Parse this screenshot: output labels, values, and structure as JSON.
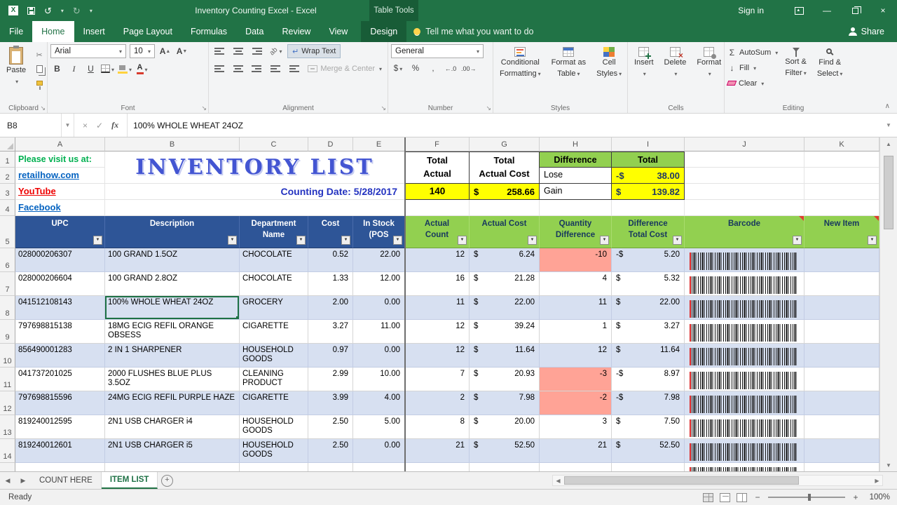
{
  "titlebar": {
    "title": "Inventory Counting Excel  -  Excel",
    "context_group": "Table Tools",
    "sign_in": "Sign in"
  },
  "tabs": {
    "file": "File",
    "home": "Home",
    "insert": "Insert",
    "page_layout": "Page Layout",
    "formulas": "Formulas",
    "data": "Data",
    "review": "Review",
    "view": "View",
    "design": "Design",
    "tell_me": "Tell me what you want to do",
    "share": "Share"
  },
  "ribbon": {
    "clipboard": {
      "paste": "Paste",
      "label": "Clipboard"
    },
    "font": {
      "name": "Arial",
      "size": "10",
      "bold": "B",
      "italic": "I",
      "underline": "U",
      "label": "Font"
    },
    "alignment": {
      "wrap": "Wrap Text",
      "merge": "Merge & Center",
      "label": "Alignment"
    },
    "number": {
      "format": "General",
      "label": "Number"
    },
    "styles": {
      "cond1": "Conditional",
      "cond2": "Formatting",
      "ft1": "Format as",
      "ft2": "Table",
      "cs1": "Cell",
      "cs2": "Styles",
      "label": "Styles"
    },
    "cells": {
      "insert": "Insert",
      "delete": "Delete",
      "format": "Format",
      "label": "Cells"
    },
    "editing": {
      "autosum": "AutoSum",
      "fill": "Fill",
      "clear": "Clear",
      "sort1": "Sort &",
      "sort2": "Filter",
      "find1": "Find &",
      "find2": "Select",
      "label": "Editing"
    }
  },
  "icons": {
    "cut": "✂",
    "undo": "↺",
    "redo": "↻",
    "sigma": "Σ",
    "fill_down": "↓",
    "wrap_return": "↵",
    "orientation": "ab",
    "letter_a": "A",
    "check": "✓",
    "cancel": "×",
    "minimize": "—",
    "close": "×",
    "dollar": "$",
    "percent": "%",
    "comma": ",",
    "inc_decimal": "←.0",
    "dec_decimal": ".00→"
  },
  "formula_bar": {
    "name_box": "B8",
    "fx": "fx",
    "content": "100% WHOLE WHEAT 24OZ"
  },
  "grid": {
    "columns": [
      "A",
      "B",
      "C",
      "D",
      "E",
      "F",
      "G",
      "H",
      "I",
      "J",
      "K"
    ],
    "rows": [
      "1",
      "2",
      "3",
      "4",
      "5",
      "6",
      "7",
      "8",
      "9",
      "10",
      "11",
      "12",
      "13",
      "14"
    ]
  },
  "info": {
    "visit": "Please visit us at:",
    "link1": "retailhow.com",
    "link2": "YouTube",
    "link3": "Facebook",
    "title": "INVENTORY LIST",
    "date": "Counting Date: 5/28/2017"
  },
  "summary": {
    "total_actual_1": "Total",
    "total_actual_2": "Actual",
    "total_cost_1": "Total",
    "total_cost_2": "Actual Cost",
    "difference": "Difference",
    "total": "Total",
    "lose": "Lose",
    "gain": "Gain",
    "actual_value": "140",
    "cost_cur": "$",
    "cost_value": "258.66",
    "lose_cur": "-$",
    "lose_value": "38.00",
    "gain_cur": "$",
    "gain_value": "139.82"
  },
  "table": {
    "headers": {
      "upc": "UPC",
      "description": "Description",
      "dept1": "Department",
      "dept2": "Name",
      "cost": "Cost",
      "stock1": "In Stock",
      "stock2": "(POS",
      "count1": "Actual",
      "count2": "Count",
      "acost": "Actual Cost",
      "qty1": "Quantity",
      "qty2": "Difference",
      "diff1": "Difference",
      "diff2": "Total Cost",
      "barcode": "Barcode",
      "new_item": "New Item"
    },
    "rows": [
      {
        "upc": "028000206307",
        "desc": "100 GRAND 1.5OZ",
        "dept": "CHOCOLATE",
        "cost": "0.52",
        "stock": "22.00",
        "count": "12",
        "cur": "$",
        "acost": "6.24",
        "qdiff": "-10",
        "dcur": "-$",
        "dcost": "5.20"
      },
      {
        "upc": "028000206604",
        "desc": "100 GRAND 2.8OZ",
        "dept": "CHOCOLATE",
        "cost": "1.33",
        "stock": "12.00",
        "count": "16",
        "cur": "$",
        "acost": "21.28",
        "qdiff": "4",
        "dcur": "$",
        "dcost": "5.32"
      },
      {
        "upc": "041512108143",
        "desc": "100% WHOLE WHEAT 24OZ",
        "dept": "GROCERY",
        "cost": "2.00",
        "stock": "0.00",
        "count": "11",
        "cur": "$",
        "acost": "22.00",
        "qdiff": "11",
        "dcur": "$",
        "dcost": "22.00"
      },
      {
        "upc": "797698815138",
        "desc": "18MG ECIG REFIL ORANGE OBSESS",
        "dept": "CIGARETTE",
        "cost": "3.27",
        "stock": "11.00",
        "count": "12",
        "cur": "$",
        "acost": "39.24",
        "qdiff": "1",
        "dcur": "$",
        "dcost": "3.27"
      },
      {
        "upc": "856490001283",
        "desc": "2 IN 1 SHARPENER",
        "dept": "HOUSEHOLD GOODS",
        "cost": "0.97",
        "stock": "0.00",
        "count": "12",
        "cur": "$",
        "acost": "11.64",
        "qdiff": "12",
        "dcur": "$",
        "dcost": "11.64"
      },
      {
        "upc": "041737201025",
        "desc": "2000 FLUSHES BLUE PLUS 3.5OZ",
        "dept": "CLEANING PRODUCT",
        "cost": "2.99",
        "stock": "10.00",
        "count": "7",
        "cur": "$",
        "acost": "20.93",
        "qdiff": "-3",
        "dcur": "-$",
        "dcost": "8.97"
      },
      {
        "upc": "797698815596",
        "desc": "24MG ECIG REFIL PURPLE HAZE",
        "dept": "CIGARETTE",
        "cost": "3.99",
        "stock": "4.00",
        "count": "2",
        "cur": "$",
        "acost": "7.98",
        "qdiff": "-2",
        "dcur": "-$",
        "dcost": "7.98"
      },
      {
        "upc": "819240012595",
        "desc": "2N1 USB CHARGER i4",
        "dept": "HOUSEHOLD GOODS",
        "cost": "2.50",
        "stock": "5.00",
        "count": "8",
        "cur": "$",
        "acost": "20.00",
        "qdiff": "3",
        "dcur": "$",
        "dcost": "7.50"
      },
      {
        "upc": "819240012601",
        "desc": "2N1 USB CHARGER i5",
        "dept": "HOUSEHOLD GOODS",
        "cost": "2.50",
        "stock": "0.00",
        "count": "21",
        "cur": "$",
        "acost": "52.50",
        "qdiff": "21",
        "dcur": "$",
        "dcost": "52.50"
      }
    ]
  },
  "sheets": {
    "tab1": "COUNT HERE",
    "tab2": "ITEM LIST"
  },
  "status": {
    "mode": "Ready",
    "zoom": "100%"
  }
}
